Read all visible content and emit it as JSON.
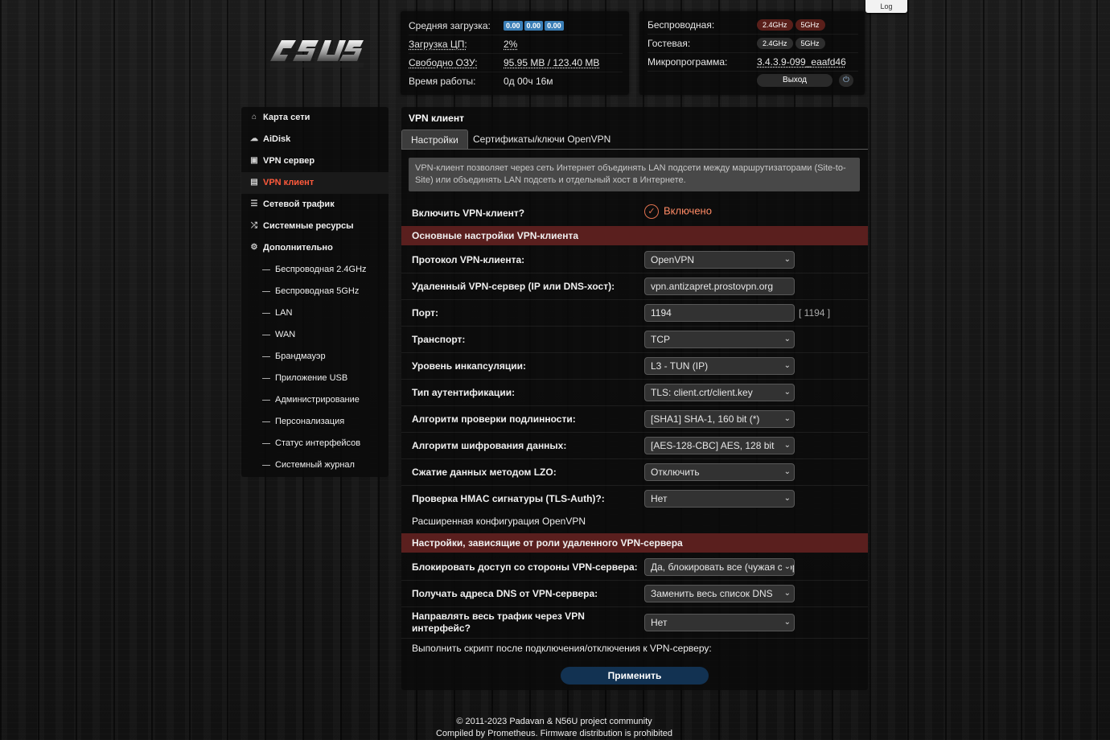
{
  "top": {
    "log_label": "Log"
  },
  "logo": {
    "alt": "ASUS"
  },
  "status": {
    "load_label": "Средняя загрузка:",
    "load_values": [
      "0.00",
      "0.00",
      "0.00"
    ],
    "cpu_label": "Загрузка ЦП:",
    "cpu_value": "2%",
    "ram_label": "Свободно ОЗУ:",
    "ram_value": "95.95 MB / 123.40 MB",
    "uptime_label": "Время работы:",
    "uptime_value": "0д 00ч 16м",
    "wireless_label": "Беспроводная:",
    "guest_label": "Гостевая:",
    "band_24": "2.4GHz",
    "band_5": "5GHz",
    "firmware_label": "Микропрограмма:",
    "firmware_value": "3.4.3.9-099_eaafd46",
    "logout_label": "Выход"
  },
  "sidebar": {
    "items": [
      {
        "label": "Карта сети",
        "icon": "home-icon"
      },
      {
        "label": "AiDisk",
        "icon": "cloud-icon"
      },
      {
        "label": "VPN сервер",
        "icon": "vpn-server-icon"
      },
      {
        "label": "VPN клиент",
        "icon": "lock-icon"
      },
      {
        "label": "Сетевой трафик",
        "icon": "traffic-icon"
      },
      {
        "label": "Системные ресурсы",
        "icon": "shuffle-icon"
      },
      {
        "label": "Дополнительно",
        "icon": "gear-icon"
      }
    ],
    "subitems": [
      "Беспроводная 2.4GHz",
      "Беспроводная 5GHz",
      "LAN",
      "WAN",
      "Брандмауэр",
      "Приложение USB",
      "Администрирование",
      "Персонализация",
      "Статус интерфейсов",
      "Системный журнал"
    ]
  },
  "main": {
    "title": "VPN клиент",
    "tabs": [
      "Настройки",
      "Сертификаты/ключи OpenVPN"
    ],
    "info": "VPN-клиент позволяет через сеть Интернет объединять LAN подсети между маршрутизаторами (Site-to-Site) или объединять LAN подсеть и отдельный хост в Интернете.",
    "enable_label": "Включить VPN-клиент?",
    "enable_value": "Включено",
    "section1": "Основные настройки VPN-клиента",
    "fields": [
      {
        "label": "Протокол VPN-клиента:",
        "value": "OpenVPN"
      },
      {
        "label": "Удаленный VPN-сервер (IP или DNS-хост):",
        "value": "vpn.antizapret.prostovpn.org"
      },
      {
        "label": "Порт:",
        "value": "1194",
        "hint": "[ 1194 ]"
      },
      {
        "label": "Транспорт:",
        "value": "TCP"
      },
      {
        "label": "Уровень инкапсуляции:",
        "value": "L3 - TUN (IP)"
      },
      {
        "label": "Тип аутентификации:",
        "value": "TLS: client.crt/client.key"
      },
      {
        "label": "Алгоритм проверки подлинности:",
        "value": "[SHA1] SHA-1, 160 bit (*)"
      },
      {
        "label": "Алгоритм шифрования данных:",
        "value": "[AES-128-CBC] AES, 128 bit"
      },
      {
        "label": "Сжатие данных методом LZO:",
        "value": "Отключить"
      },
      {
        "label": "Проверка HMAC сигнатуры (TLS-Auth)?:",
        "value": "Нет"
      }
    ],
    "advanced_link": "Расширенная конфигурация OpenVPN",
    "section2": "Настройки, зависящие от роли удаленного VPN-сервера",
    "role_fields": [
      {
        "label": "Блокировать доступ со стороны VPN-сервера:",
        "value": "Да, блокировать все (чужая сторона)"
      },
      {
        "label": "Получать адреса DNS от VPN-сервера:",
        "value": "Заменить весь список DNS"
      },
      {
        "label_line1": "Направлять весь трафик через VPN",
        "label_line2": "интерфейс?",
        "value": "Нет"
      }
    ],
    "script_label": "Выполнить скрипт после подключения/отключения к VPN-серверу:",
    "apply_label": "Применить"
  },
  "footer": {
    "line1": "© 2011-2023 Padavan & N56U project community",
    "line2": "Compiled by Prometheus. Firmware distribution is prohibited"
  }
}
